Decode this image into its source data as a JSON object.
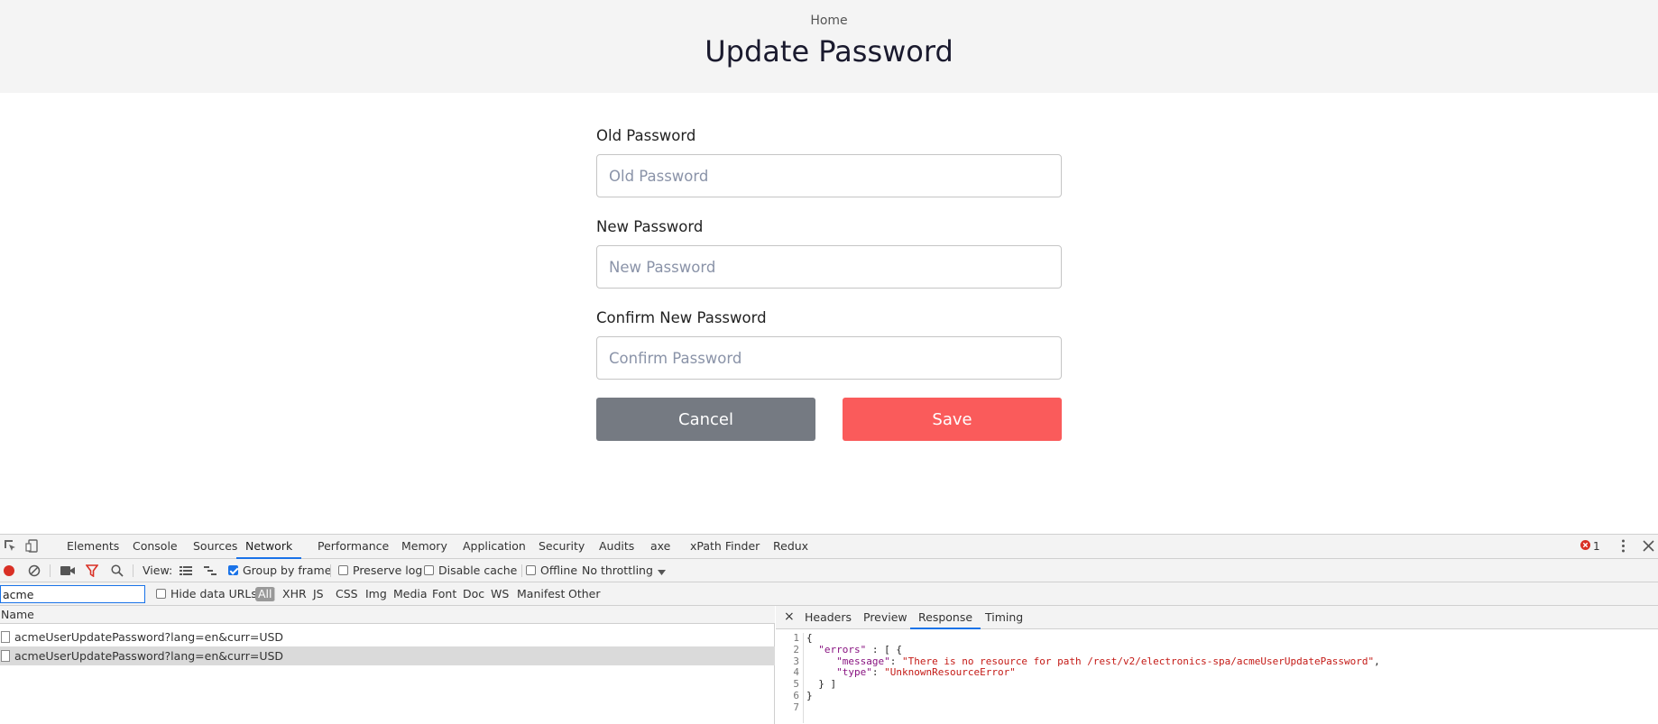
{
  "header": {
    "breadcrumb": "Home",
    "title": "Update Password"
  },
  "form": {
    "old_password": {
      "label": "Old Password",
      "placeholder": "Old Password",
      "value": ""
    },
    "new_password": {
      "label": "New Password",
      "placeholder": "New Password",
      "value": ""
    },
    "confirm_password": {
      "label": "Confirm New Password",
      "placeholder": "Confirm Password",
      "value": ""
    },
    "cancel_label": "Cancel",
    "save_label": "Save"
  },
  "colors": {
    "cancel_bg": "#757a82",
    "save_bg": "#fa5b5b",
    "devtools_accent": "#1a73e8"
  },
  "devtools": {
    "tabs": [
      "Elements",
      "Console",
      "Sources",
      "Network",
      "Performance",
      "Memory",
      "Application",
      "Security",
      "Audits",
      "axe",
      "xPath Finder",
      "Redux"
    ],
    "active_tab": "Network",
    "error_count": "1",
    "icons": [
      "inspect-icon",
      "device-toggle-icon",
      "record-icon",
      "clear-icon",
      "camera-icon",
      "filter-icon",
      "search-icon",
      "more-icon",
      "close-icon"
    ],
    "toolbar": {
      "view_label": "View:",
      "group_by_frame": "Group by frame",
      "preserve_log": "Preserve log",
      "disable_cache": "Disable cache",
      "offline": "Offline",
      "throttling": "No throttling"
    },
    "filter": {
      "value": "acme",
      "hide_data_urls": "Hide data URLs",
      "types": [
        "All",
        "XHR",
        "JS",
        "CSS",
        "Img",
        "Media",
        "Font",
        "Doc",
        "WS",
        "Manifest",
        "Other"
      ]
    },
    "requests": {
      "column_name": "Name",
      "rows": [
        "acmeUserUpdatePassword?lang=en&curr=USD",
        "acmeUserUpdatePassword?lang=en&curr=USD"
      ]
    },
    "response": {
      "close": "×",
      "tabs": [
        "Headers",
        "Preview",
        "Response",
        "Timing"
      ],
      "active_tab": "Response",
      "line_numbers": [
        "1",
        "2",
        "3",
        "4",
        "5",
        "6",
        "7"
      ],
      "lines": {
        "l1": "{",
        "l2_key": "\"errors\"",
        "l2_rest": " : [ {",
        "l3_key": "\"message\"",
        "l3_value": "\"There is no resource for path /rest/v2/electronics-spa/acmeUserUpdatePassword\"",
        "l4_key": "\"type\"",
        "l4_value": "\"UnknownResourceError\"",
        "l5": "  } ]",
        "l6": "}"
      }
    }
  }
}
